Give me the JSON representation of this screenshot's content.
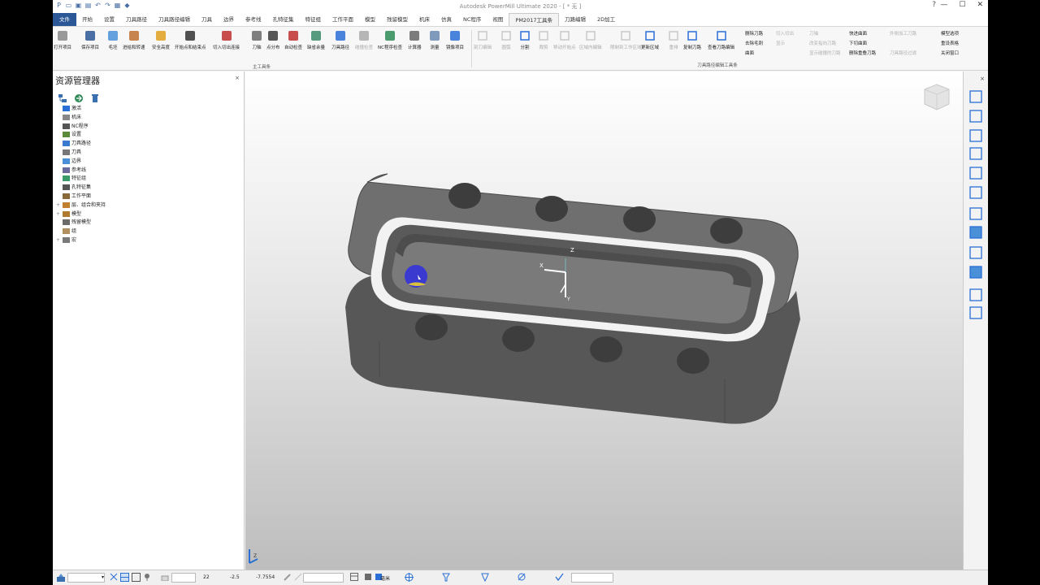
{
  "window": {
    "title": "Autodesk PowerMill Ultimate 2020  - [ * 无 ]",
    "help_glyph": "?",
    "minimize": "—",
    "maximize": "☐",
    "close": "✕"
  },
  "menu_tabs": [
    "文件",
    "开始",
    "设置",
    "刀具路径",
    "刀具路径编辑",
    "刀具",
    "边界",
    "参考线",
    "孔特征集",
    "特征组",
    "工作平面",
    "模型",
    "残留模型",
    "机床",
    "仿真",
    "NC程序",
    "视图",
    "PM2017工具条",
    "刀路编辑",
    "2D加工"
  ],
  "active_tab_index": 17,
  "ribbon": {
    "main_buttons": [
      "打开项目",
      "保存项目",
      "毛坯",
      "进给和转速",
      "安全高度",
      "开始点和结束点",
      "切入切出连接",
      "刀轴",
      "点分布",
      "自动检查",
      "缺省余量",
      "刀具路径",
      "碰撞检查",
      "NC程序检查",
      "计算器",
      "测量",
      "镜像项目"
    ],
    "main_group_label": "主工具条",
    "edit_buttons": [
      "刻刀编辑",
      "圆弧",
      "分割",
      "裁剪",
      "移动开始点",
      "区域内编辑",
      "限制到工作区域",
      "更新区域",
      "重排",
      "复制刀路",
      "查看刀路编辑"
    ],
    "edit_group_label": "刀具路径编辑工具条",
    "small_items": [
      [
        "删除刀路",
        "切入切出",
        "刀轴",
        "快进曲面",
        "外侧加工刀路",
        "模型选项"
      ],
      [
        "去除毛刺",
        "显示",
        "改变指向刀路",
        "下切曲面",
        "",
        "重设表格"
      ],
      [
        "曲面",
        "",
        "显示碰撞的刀路",
        "删除重叠刀路",
        "刀具路径过滤",
        "关闭窗口"
      ]
    ]
  },
  "explorer": {
    "title": "资源管理器",
    "close": "×",
    "items": [
      {
        "label": "激活",
        "color": "#2a6fd6",
        "expand": ""
      },
      {
        "label": "机床",
        "color": "#888888",
        "expand": ""
      },
      {
        "label": "NC程序",
        "color": "#555555",
        "expand": ""
      },
      {
        "label": "设置",
        "color": "#5a8a3a",
        "expand": ""
      },
      {
        "label": "刀具路径",
        "color": "#3a7ad0",
        "expand": ""
      },
      {
        "label": "刀具",
        "color": "#777777",
        "expand": ""
      },
      {
        "label": "边界",
        "color": "#4a90d9",
        "expand": ""
      },
      {
        "label": "参考线",
        "color": "#6a6aa0",
        "expand": ""
      },
      {
        "label": "特征组",
        "color": "#3a9a6a",
        "expand": ""
      },
      {
        "label": "孔特征集",
        "color": "#555555",
        "expand": ""
      },
      {
        "label": "工作平面",
        "color": "#8a6a3a",
        "expand": ""
      },
      {
        "label": "层、组合和夹持",
        "color": "#c08030",
        "expand": "+"
      },
      {
        "label": "模型",
        "color": "#b07a30",
        "expand": "+"
      },
      {
        "label": "残留模型",
        "color": "#6a6a6a",
        "expand": ""
      },
      {
        "label": "组",
        "color": "#b09060",
        "expand": ""
      },
      {
        "label": "宏",
        "color": "#7a7a7a",
        "expand": "+"
      }
    ]
  },
  "viewport": {
    "axis_x": "X",
    "axis_y": "Y",
    "axis_z": "Z",
    "corner_label": "Z"
  },
  "status": {
    "value1": "22",
    "value2": "-2.5",
    "value3": "-7.7554",
    "unit": "毫米"
  },
  "colors": {
    "accent": "#2b5797",
    "part_top": "#6f6f6f",
    "part_side": "#545454",
    "tool": "#3a3ad0"
  }
}
